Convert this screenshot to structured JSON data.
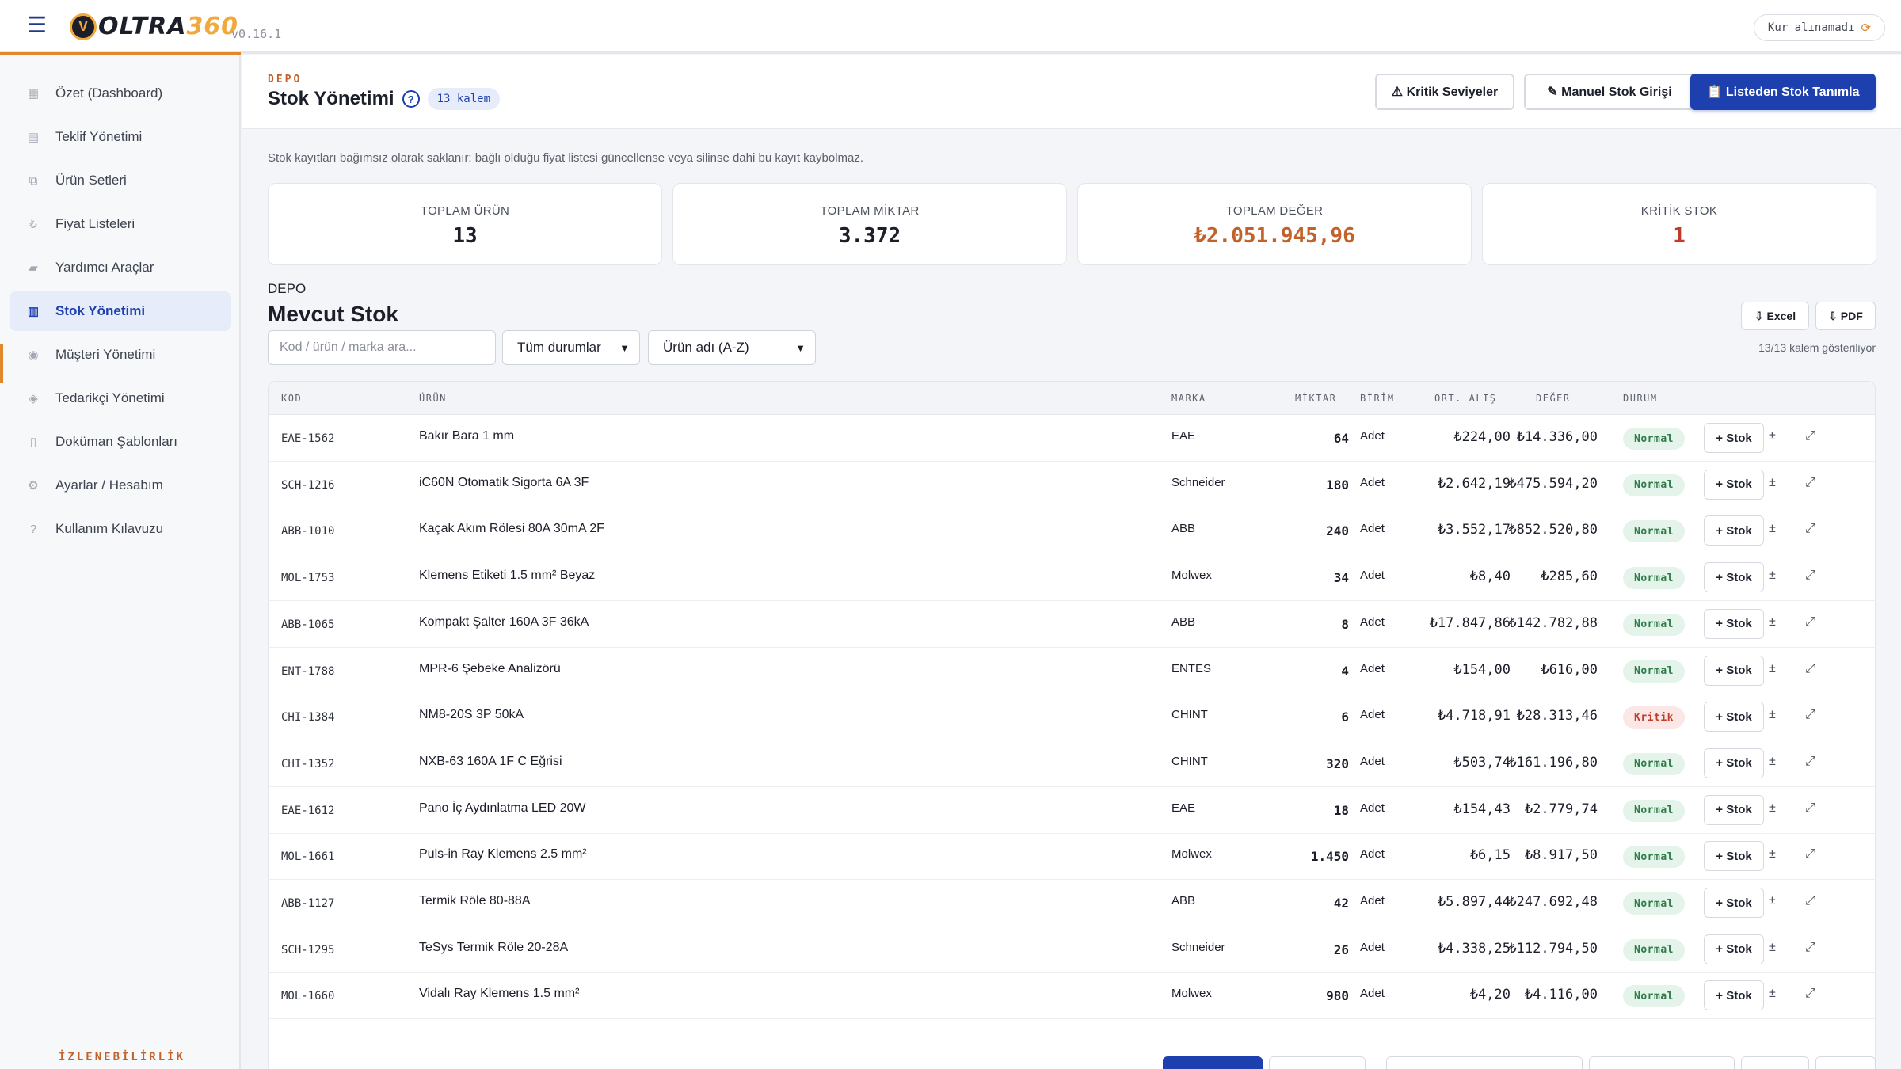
{
  "app": {
    "logo_text_dark": "OLTRA",
    "logo_text_orange": "360",
    "version": "v0.16.1",
    "currency_status": "Kur alınamadı"
  },
  "sidebar": {
    "items": [
      {
        "label": "Özet (Dashboard)",
        "icon": "dashboard-icon",
        "glyph": "▦",
        "active": false
      },
      {
        "label": "Teklif Yönetimi",
        "icon": "document-list-icon",
        "glyph": "▤",
        "active": false
      },
      {
        "label": "Ürün Setleri",
        "icon": "sets-icon",
        "glyph": "⧉",
        "active": false
      },
      {
        "label": "Fiyat Listeleri",
        "icon": "lira-icon",
        "glyph": "₺",
        "active": false
      },
      {
        "label": "Yardımcı Araçlar",
        "icon": "toolbox-icon",
        "glyph": "▰",
        "active": false
      },
      {
        "label": "Stok Yönetimi",
        "icon": "stock-icon",
        "glyph": "▥",
        "active": true
      },
      {
        "label": "Müşteri Yönetimi",
        "icon": "customer-icon",
        "glyph": "◉",
        "active": false
      },
      {
        "label": "Tedarikçi Yönetimi",
        "icon": "supplier-icon",
        "glyph": "◈",
        "active": false
      },
      {
        "label": "Doküman Şablonları",
        "icon": "template-icon",
        "glyph": "▯",
        "active": false
      },
      {
        "label": "Ayarlar / Hesabım",
        "icon": "settings-icon",
        "glyph": "⚙",
        "active": false
      },
      {
        "label": "Kullanım Kılavuzu",
        "icon": "help-icon",
        "glyph": "?",
        "active": false
      }
    ]
  },
  "header": {
    "eyebrow": "DEPO",
    "title": "Stok Yönetimi",
    "help": "?",
    "count": "13 kalem",
    "buttons": {
      "critical": "⚠ Kritik Seviyeler",
      "manual": "✎ Manuel Stok Girişi",
      "from_list": "📋 Listeden Stok Tanımla"
    }
  },
  "notice": "Stok kayıtları bağımsız olarak saklanır: bağlı olduğu fiyat listesi güncellense veya silinse dahi bu kayıt kaybolmaz.",
  "stats": [
    {
      "label": "TOPLAM ÜRÜN",
      "value": "13",
      "tone": ""
    },
    {
      "label": "TOPLAM MİKTAR",
      "value": "3.372",
      "tone": ""
    },
    {
      "label": "TOPLAM DEĞER",
      "value": "₺2.051.945,96",
      "tone": "orange"
    },
    {
      "label": "KRİTİK STOK",
      "value": "1",
      "tone": "red"
    }
  ],
  "section": {
    "eyebrow": "DEPO",
    "title": "Mevcut Stok",
    "excel": "⇩ Excel",
    "pdf": "⇩ PDF",
    "search_placeholder": "Kod / ürün / marka ara...",
    "status_filter": "Tüm durumlar",
    "sort": "Ürün adı (A-Z)",
    "showing": "13/13 kalem gösteriliyor"
  },
  "table": {
    "headers": {
      "code": "KOD",
      "name": "ÜRÜN",
      "brand": "MARKA",
      "qty": "MİKTAR",
      "unit": "BİRİM",
      "avg": "ORT. ALIŞ",
      "value": "DEĞER",
      "status": "DURUM"
    },
    "add_label": "+ Stok",
    "adjust_glyph": "±",
    "expand_glyph": "⤢",
    "rows": [
      {
        "code": "EAE-1562",
        "name": "Bakır Bara 1 mm",
        "brand": "EAE",
        "qty": "64",
        "unit": "Adet",
        "avg": "₺224,00",
        "value": "₺14.336,00",
        "status": "Normal"
      },
      {
        "code": "SCH-1216",
        "name": "iC60N Otomatik Sigorta 6A 3F",
        "brand": "Schneider",
        "qty": "180",
        "unit": "Adet",
        "avg": "₺2.642,19",
        "value": "₺475.594,20",
        "status": "Normal"
      },
      {
        "code": "ABB-1010",
        "name": "Kaçak Akım Rölesi 80A 30mA 2F",
        "brand": "ABB",
        "qty": "240",
        "unit": "Adet",
        "avg": "₺3.552,17",
        "value": "₺852.520,80",
        "status": "Normal"
      },
      {
        "code": "MOL-1753",
        "name": "Klemens Etiketi 1.5 mm² Beyaz",
        "brand": "Molwex",
        "qty": "34",
        "unit": "Adet",
        "avg": "₺8,40",
        "value": "₺285,60",
        "status": "Normal"
      },
      {
        "code": "ABB-1065",
        "name": "Kompakt Şalter 160A 3F 36kA",
        "brand": "ABB",
        "qty": "8",
        "unit": "Adet",
        "avg": "₺17.847,86",
        "value": "₺142.782,88",
        "status": "Normal"
      },
      {
        "code": "ENT-1788",
        "name": "MPR-6 Şebeke Analizörü",
        "brand": "ENTES",
        "qty": "4",
        "unit": "Adet",
        "avg": "₺154,00",
        "value": "₺616,00",
        "status": "Normal"
      },
      {
        "code": "CHI-1384",
        "name": "NM8-20S 3P 50kA",
        "brand": "CHINT",
        "qty": "6",
        "unit": "Adet",
        "avg": "₺4.718,91",
        "value": "₺28.313,46",
        "status": "Kritik"
      },
      {
        "code": "CHI-1352",
        "name": "NXB-63 160A 1F C Eğrisi",
        "brand": "CHINT",
        "qty": "320",
        "unit": "Adet",
        "avg": "₺503,74",
        "value": "₺161.196,80",
        "status": "Normal"
      },
      {
        "code": "EAE-1612",
        "name": "Pano İç Aydınlatma LED 20W",
        "brand": "EAE",
        "qty": "18",
        "unit": "Adet",
        "avg": "₺154,43",
        "value": "₺2.779,74",
        "status": "Normal"
      },
      {
        "code": "MOL-1661",
        "name": "Puls-in Ray Klemens 2.5 mm²",
        "brand": "Molwex",
        "qty": "1.450",
        "unit": "Adet",
        "avg": "₺6,15",
        "value": "₺8.917,50",
        "status": "Normal"
      },
      {
        "code": "ABB-1127",
        "name": "Termik Röle 80-88A",
        "brand": "ABB",
        "qty": "42",
        "unit": "Adet",
        "avg": "₺5.897,44",
        "value": "₺247.692,48",
        "status": "Normal"
      },
      {
        "code": "SCH-1295",
        "name": "TeSys Termik Röle 20-28A",
        "brand": "Schneider",
        "qty": "26",
        "unit": "Adet",
        "avg": "₺4.338,25",
        "value": "₺112.794,50",
        "status": "Normal"
      },
      {
        "code": "MOL-1660",
        "name": "Vidalı Ray Klemens 1.5 mm²",
        "brand": "Molwex",
        "qty": "980",
        "unit": "Adet",
        "avg": "₺4,20",
        "value": "₺4.116,00",
        "status": "Normal"
      }
    ]
  },
  "bottom": {
    "eyebrow": "İZLENEBİLİRLİK"
  },
  "colors": {
    "primary": "#1e3fae",
    "accent": "#e0882b",
    "normal": "#2e7d4a",
    "critical": "#c23a2a"
  }
}
